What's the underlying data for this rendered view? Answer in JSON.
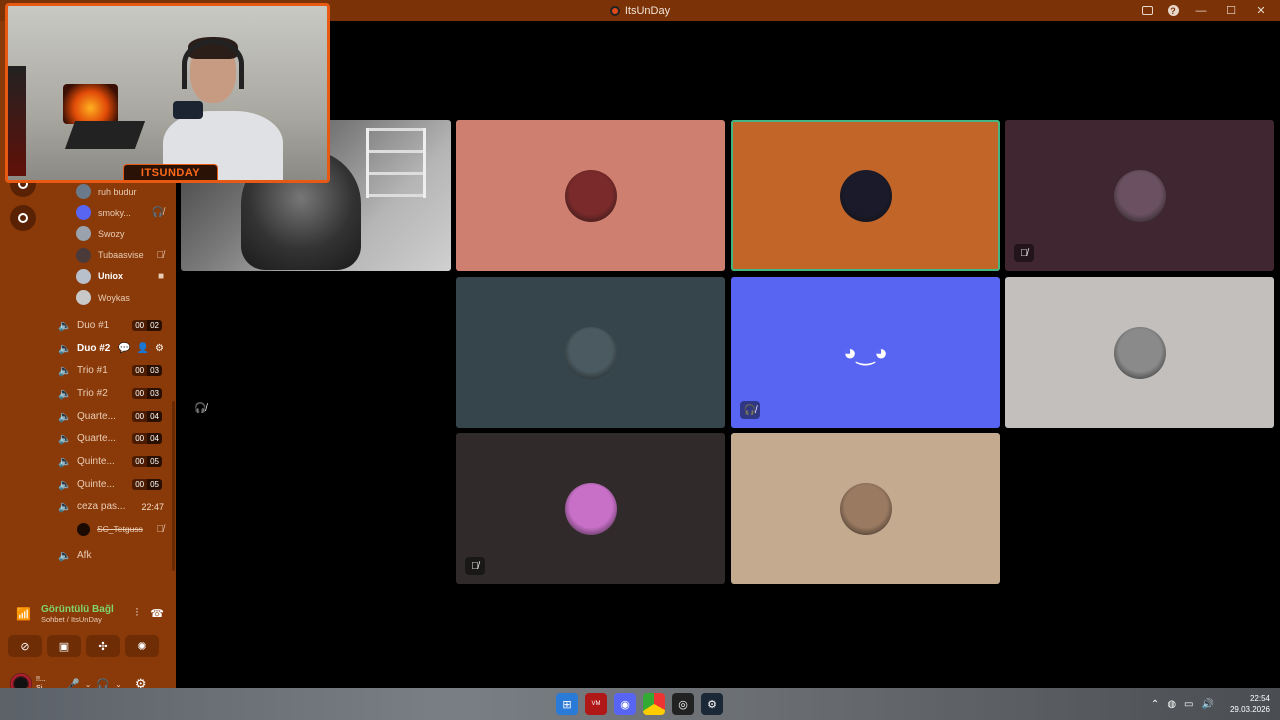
{
  "window": {
    "title": "ItsUnDay"
  },
  "sidebar": {
    "users": [
      {
        "name": "ruh budur",
        "status": "",
        "bold": false,
        "color": "#6a7a8a"
      },
      {
        "name": "smoky...",
        "status": "🎧̸ ",
        "bold": false,
        "color": "#5865f2"
      },
      {
        "name": "Swozy",
        "status": "",
        "bold": false,
        "color": "#9aa3ad"
      },
      {
        "name": "Tubaasvise",
        "status": "🎙̸",
        "bold": false,
        "color": "#4a3a3a"
      },
      {
        "name": "Uniox",
        "status": "■",
        "bold": true,
        "color": "#b8c0cc"
      },
      {
        "name": "Woykas",
        "status": "",
        "bold": false,
        "color": "#c8c8c8"
      }
    ],
    "channels": [
      {
        "name": "Duo #1",
        "a": "00",
        "b": "02",
        "type": "pill"
      },
      {
        "name": "Duo #2",
        "type": "active"
      },
      {
        "name": "Trio #1",
        "a": "00",
        "b": "03",
        "type": "pill"
      },
      {
        "name": "Trio #2",
        "a": "00",
        "b": "03",
        "type": "pill"
      },
      {
        "name": "Quarte...",
        "a": "00",
        "b": "04",
        "type": "pill"
      },
      {
        "name": "Quarte...",
        "a": "00",
        "b": "04",
        "type": "pill"
      },
      {
        "name": "Quinte...",
        "a": "00",
        "b": "05",
        "type": "pill"
      },
      {
        "name": "Quinte...",
        "a": "00",
        "b": "05",
        "type": "pill"
      },
      {
        "name": "ceza pas...",
        "time": "22:47",
        "type": "time"
      }
    ],
    "sub_user": {
      "name": "SC_Tetguss",
      "status": "🎙̸"
    },
    "afk_channel": "Afk",
    "voice": {
      "status": "Görüntülü Bağl",
      "location": "Sohbet / ItsUnDay"
    },
    "me": {
      "name_line1": "!!...",
      "name_line2": "Si"
    }
  },
  "grid": {
    "tiles": [
      {
        "color": "#cf7f6f",
        "avatar": "#7a2a2a",
        "badge": ""
      },
      {
        "color": "#c26528",
        "avatar": "#1a1a2a",
        "badge": "",
        "speaking": true
      },
      {
        "color": "#3f2630",
        "avatar": "#6a5060",
        "badge": "🎙̸"
      },
      {
        "color": "#36444b",
        "avatar": "#4a5a60",
        "badge": ""
      },
      {
        "color": "#5865f2",
        "avatar": "",
        "badge": "🎧̸",
        "discord": true
      },
      {
        "color": "#c2bfbc",
        "avatar": "#8a8a8a",
        "badge": ""
      },
      {
        "color": "#302b2a",
        "avatar": "#c870c8",
        "badge": "🎙̸"
      },
      {
        "color": "#c4ab90",
        "avatar": "#9a7a60",
        "badge": ""
      }
    ]
  },
  "webcam": {
    "label": "ITSUNDAY"
  },
  "taskbar": {
    "time": "22:54",
    "date": "29.03.2026"
  }
}
